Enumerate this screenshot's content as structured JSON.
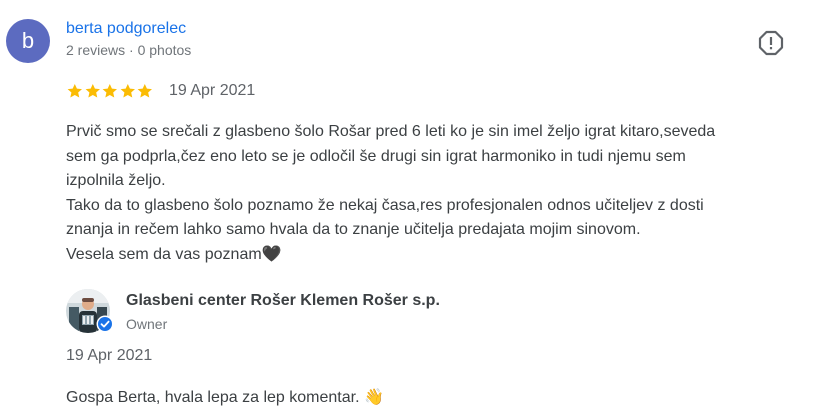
{
  "review": {
    "avatar_letter": "b",
    "avatar_color": "#5c6bc0",
    "reviewer_name": "berta podgorelec",
    "reviewer_meta": "2 reviews · 0 photos",
    "report_icon": "report-flag-icon",
    "rating": 5,
    "rating_max": 5,
    "star_color": "#fbbc04",
    "date": "19 Apr 2021",
    "text_lines": [
      "Prvič smo se srečali z glasbeno šolo Rošar pred 6 leti ko je sin imel željo igrat kitaro,seveda",
      "sem ga podprla,čez eno leto se je odločil še drugi sin igrat harmoniko in tudi njemu sem",
      "izpolnila željo.",
      "Tako da to glasbeno šolo poznamo že nekaj časa,res profesjonalen odnos učiteljev z dosti",
      "znanja in rečem lahko samo hvala da to znanje učitelja predajata mojim sinovom.",
      "Vesela sem da vas poznam🖤"
    ]
  },
  "owner_reply": {
    "name": "Glasbeni center Rošer Klemen Rošer s.p.",
    "role": "Owner",
    "badge_icon": "verified-check-icon",
    "badge_color": "#1a73e8",
    "date": "19 Apr 2021",
    "text": "Gospa Berta, hvala lepa za lep komentar. 👋"
  }
}
